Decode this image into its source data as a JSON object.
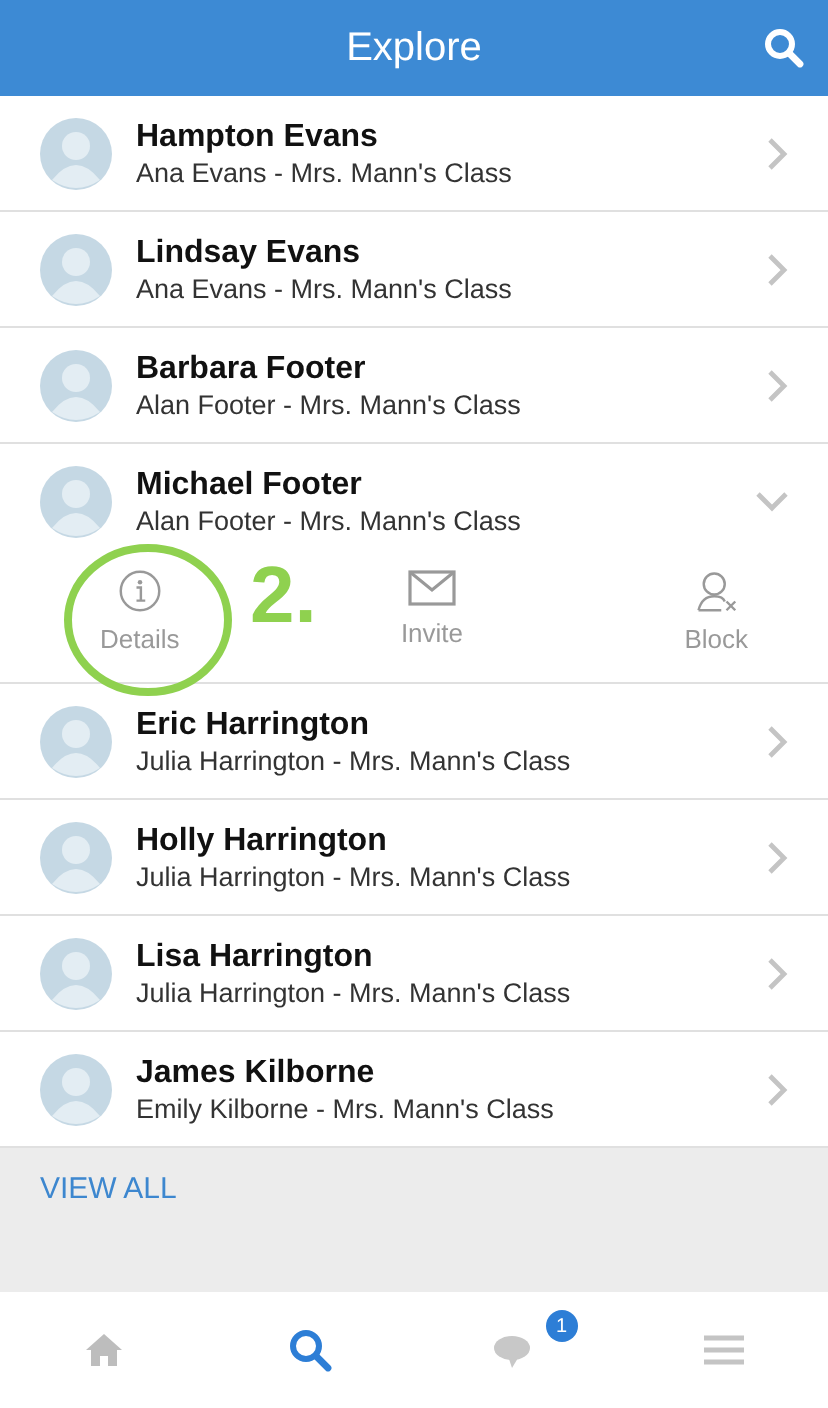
{
  "header": {
    "title": "Explore"
  },
  "contacts": [
    {
      "name": "Hampton Evans",
      "subtitle": "Ana Evans - Mrs. Mann's Class",
      "expanded": false
    },
    {
      "name": "Lindsay Evans",
      "subtitle": "Ana Evans - Mrs. Mann's Class",
      "expanded": false
    },
    {
      "name": "Barbara  Footer",
      "subtitle": "Alan Footer - Mrs. Mann's Class",
      "expanded": false
    },
    {
      "name": "Michael Footer",
      "subtitle": "Alan Footer - Mrs. Mann's Class",
      "expanded": true,
      "actions": [
        {
          "kind": "info",
          "label": "Details"
        },
        {
          "kind": "mail",
          "label": "Invite"
        },
        {
          "kind": "block",
          "label": "Block"
        }
      ]
    },
    {
      "name": "Eric Harrington",
      "subtitle": "Julia Harrington - Mrs. Mann's Class",
      "expanded": false
    },
    {
      "name": "Holly Harrington",
      "subtitle": "Julia Harrington - Mrs. Mann's Class",
      "expanded": false
    },
    {
      "name": "Lisa Harrington",
      "subtitle": "Julia Harrington - Mrs. Mann's Class",
      "expanded": false
    },
    {
      "name": "James Kilborne",
      "subtitle": "Emily Kilborne - Mrs. Mann's Class",
      "expanded": false
    }
  ],
  "view_all": "VIEW ALL",
  "tabs": [
    {
      "kind": "home",
      "selected": false
    },
    {
      "kind": "search",
      "selected": true
    },
    {
      "kind": "chat",
      "selected": false,
      "badge": "1"
    },
    {
      "kind": "menu",
      "selected": false
    }
  ],
  "annotation": {
    "label": "2."
  }
}
